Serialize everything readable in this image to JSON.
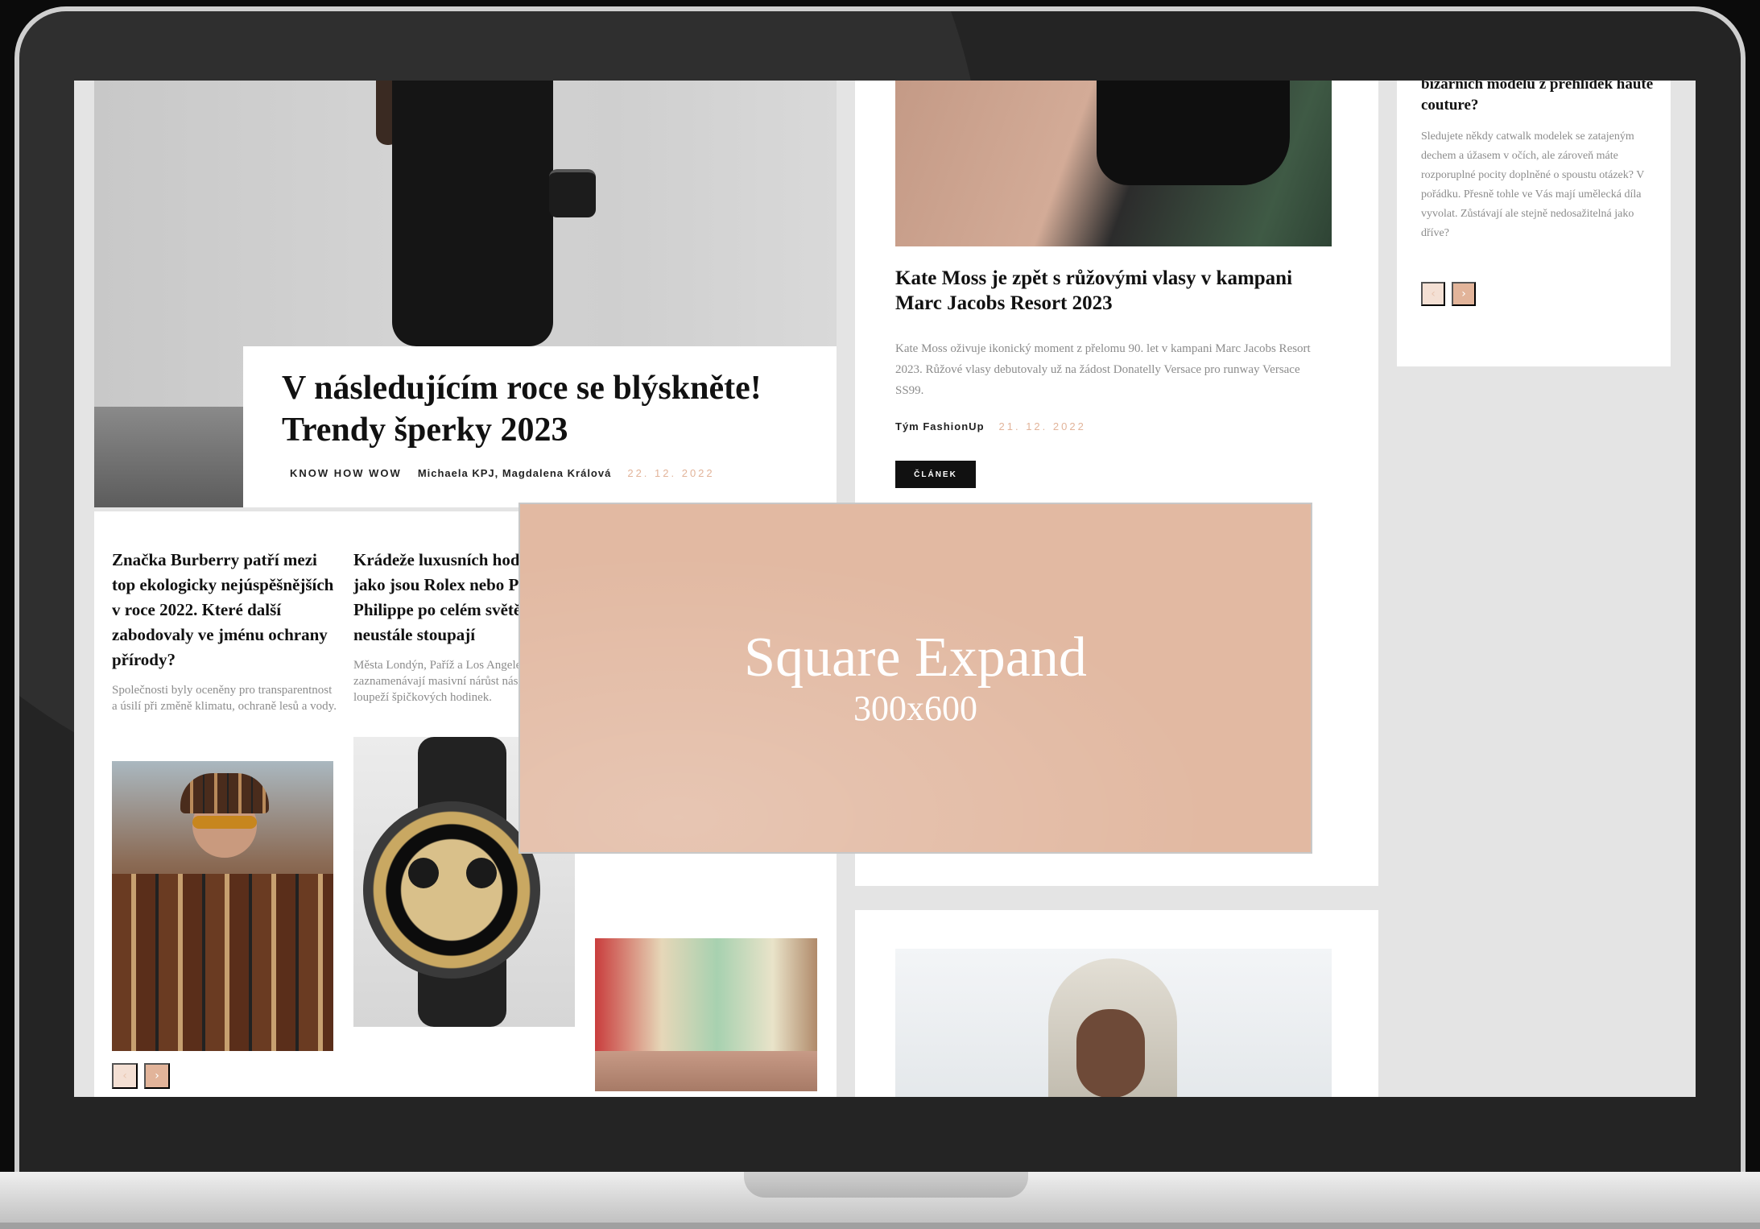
{
  "hero": {
    "title_line1": "V následujícím roce se blýskněte!",
    "title_line2": "Trendy šperky 2023",
    "category": "KNOW HOW WOW",
    "authors": "Michaela KPJ, Magdalena Králová",
    "date": "22. 12. 2022"
  },
  "left_articles": [
    {
      "title": "Značka Burberry patří mezi top ekologicky nejúspěšnějších v roce 2022. Které další zabodovaly ve jménu ochrany přírody?",
      "excerpt": "Společnosti byly oceněny pro transparentnost a úsilí při změně klimatu, ochraně lesů a vody."
    },
    {
      "title": "Krádeže luxusních hodinek jako jsou Rolex nebo Patek Philippe po celém světě neustále stoupají",
      "excerpt": "Města Londýn, Paříž a Los Angeles zaznamenávají masivní nárůst násilných loupeží špičkových hodinek."
    }
  ],
  "middle_article": {
    "title": "Kate Moss je zpět s růžovými vlasy v kampani Marc Jacobs Resort 2023",
    "excerpt": "Kate Moss oživuje ikonický moment z přelomu 90. let v kampani Marc Jacobs Resort 2023. Růžové vlasy debutovaly už na žádost Donatelly Versace pro runway Versace SS99.",
    "author": "Tým FashionUp",
    "date": "21. 12. 2022",
    "button_label": "ČLÁNEK"
  },
  "right_article": {
    "title": "bizarních modelů z přehlídek haute couture?",
    "excerpt": "Sledujete někdy catwalk modelek se zatajeným dechem a úžasem v očích, ale zároveň máte rozporuplné pocity doplněné o spoustu otázek? V pořádku. Přesně tohle ve Vás mají umělecká díla vyvolat. Zůstávají ale stejně nedosažitelná jako dříve?"
  },
  "pager": {
    "prev": "‹",
    "next": "›"
  },
  "ad": {
    "title": "Square Expand",
    "size": "300x600"
  },
  "colors": {
    "accent": "#e2b49a",
    "ad_background": "#e2b9a2",
    "button": "#111111"
  }
}
